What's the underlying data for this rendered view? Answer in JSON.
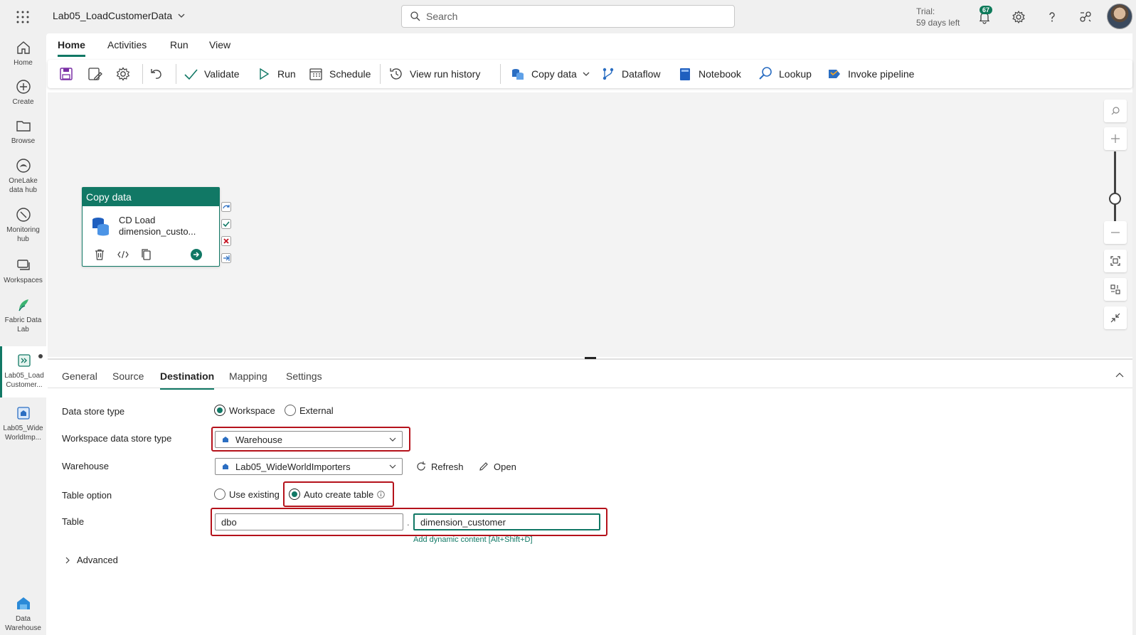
{
  "header": {
    "app_title": "Lab05_LoadCustomerData",
    "search_placeholder": "Search",
    "trial_line1": "Trial:",
    "trial_line2": "59 days left",
    "notification_count": "67"
  },
  "leftnav": {
    "items": [
      {
        "label": "Home"
      },
      {
        "label": "Create"
      },
      {
        "label": "Browse"
      },
      {
        "label1": "OneLake",
        "label2": "data hub"
      },
      {
        "label1": "Monitoring",
        "label2": "hub"
      },
      {
        "label": "Workspaces"
      },
      {
        "label1": "Fabric Data",
        "label2": "Lab"
      },
      {
        "label1": "Lab05_Load",
        "label2": "Customer..."
      },
      {
        "label1": "Lab05_Wide",
        "label2": "WorldImp..."
      },
      {
        "label1": "Data",
        "label2": "Warehouse"
      }
    ]
  },
  "ribbon": {
    "tabs": [
      "Home",
      "Activities",
      "Run",
      "View"
    ],
    "active_tab": "Home"
  },
  "toolbar": {
    "validate": "Validate",
    "run": "Run",
    "schedule": "Schedule",
    "view_run_history": "View run history",
    "copy_data": "Copy data",
    "dataflow": "Dataflow",
    "notebook": "Notebook",
    "lookup": "Lookup",
    "invoke_pipeline": "Invoke pipeline"
  },
  "activity": {
    "type": "Copy data",
    "name_line1": "CD Load",
    "name_line2": "dimension_custo..."
  },
  "properties": {
    "tabs": [
      "General",
      "Source",
      "Destination",
      "Mapping",
      "Settings"
    ],
    "active_tab": "Destination",
    "data_store_type": {
      "label": "Data store type",
      "options": [
        "Workspace",
        "External"
      ],
      "selected": "Workspace"
    },
    "workspace_data_store_type": {
      "label": "Workspace data store type",
      "value": "Warehouse"
    },
    "warehouse": {
      "label": "Warehouse",
      "value": "Lab05_WideWorldImporters",
      "refresh": "Refresh",
      "open": "Open"
    },
    "table_option": {
      "label": "Table option",
      "options": [
        "Use existing",
        "Auto create table"
      ],
      "selected": "Auto create table"
    },
    "table": {
      "label": "Table",
      "schema": "dbo",
      "separator": ".",
      "name": "dimension_customer",
      "dynamic_hint": "Add dynamic content [Alt+Shift+D]"
    },
    "advanced": "Advanced"
  },
  "colors": {
    "accent": "#117865",
    "highlight": "#b5121b"
  }
}
